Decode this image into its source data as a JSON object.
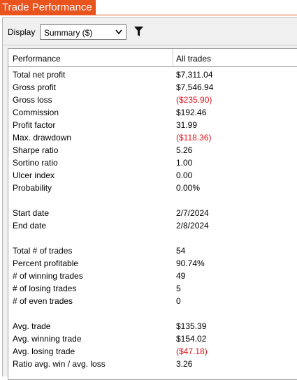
{
  "window": {
    "title": "Trade Performance"
  },
  "toolbar": {
    "display_label": "Display",
    "display_select": {
      "value": "Summary ($)"
    }
  },
  "colors": {
    "accent": "#e8531e",
    "negative": "#e0141e"
  },
  "grid": {
    "columns": [
      "Performance",
      "All trades"
    ],
    "rows": [
      {
        "label": "Total net profit",
        "value": "$7,311.04",
        "negative": false
      },
      {
        "label": "Gross profit",
        "value": "$7,546.94",
        "negative": false
      },
      {
        "label": "Gross loss",
        "value": "($235.90)",
        "negative": true
      },
      {
        "label": "Commission",
        "value": "$192.46",
        "negative": false
      },
      {
        "label": "Profit factor",
        "value": "31.99",
        "negative": false
      },
      {
        "label": "Max. drawdown",
        "value": "($118.36)",
        "negative": true
      },
      {
        "label": "Sharpe ratio",
        "value": "5.26",
        "negative": false
      },
      {
        "label": "Sortino ratio",
        "value": "1.00",
        "negative": false
      },
      {
        "label": "Ulcer index",
        "value": "0.00",
        "negative": false
      },
      {
        "label": "Probability",
        "value": "0.00%",
        "negative": false
      },
      {
        "label": "",
        "value": "",
        "negative": false
      },
      {
        "label": "Start date",
        "value": "2/7/2024",
        "negative": false
      },
      {
        "label": "End date",
        "value": "2/8/2024",
        "negative": false
      },
      {
        "label": "",
        "value": "",
        "negative": false
      },
      {
        "label": "Total # of trades",
        "value": "54",
        "negative": false
      },
      {
        "label": "Percent profitable",
        "value": "90.74%",
        "negative": false
      },
      {
        "label": "# of winning trades",
        "value": "49",
        "negative": false
      },
      {
        "label": "# of losing trades",
        "value": "5",
        "negative": false
      },
      {
        "label": "# of even trades",
        "value": "0",
        "negative": false
      },
      {
        "label": "",
        "value": "",
        "negative": false
      },
      {
        "label": "Avg. trade",
        "value": "$135.39",
        "negative": false
      },
      {
        "label": "Avg. winning trade",
        "value": "$154.02",
        "negative": false
      },
      {
        "label": "Avg. losing trade",
        "value": "($47.18)",
        "negative": true
      },
      {
        "label": "Ratio avg. win / avg. loss",
        "value": "3.26",
        "negative": false
      }
    ]
  }
}
